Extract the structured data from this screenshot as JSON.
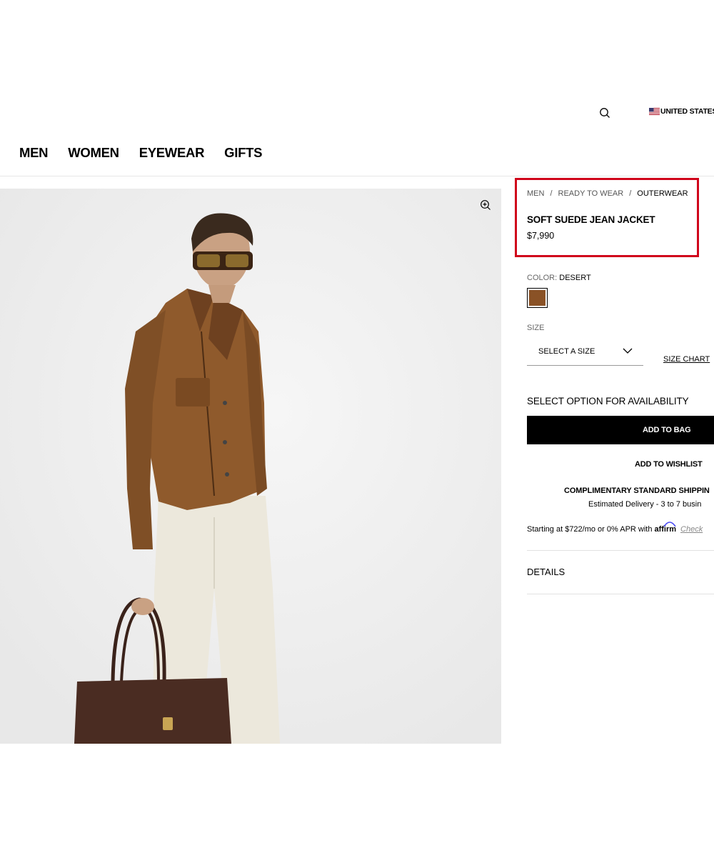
{
  "header": {
    "search_icon": "search-icon",
    "country": "UNITED STATES",
    "flag_icon": "us-flag-icon"
  },
  "nav": {
    "items": [
      "MEN",
      "WOMEN",
      "EYEWEAR",
      "GIFTS"
    ]
  },
  "product": {
    "breadcrumb": [
      "MEN",
      "READY TO WEAR",
      "OUTERWEAR"
    ],
    "breadcrumb_separator": "/",
    "title": "SOFT SUEDE JEAN JACKET",
    "price": "$7,990",
    "zoom_icon": "zoom-in-icon",
    "highlight_color": "#d0021b"
  },
  "options": {
    "color_label": "COLOR:",
    "color_value": "DESERT",
    "swatch_color": "#8a5226",
    "size_label": "SIZE",
    "size_select": "SELECT A SIZE",
    "size_chart": "SIZE CHART",
    "availability": "SELECT OPTION FOR AVAILABILITY"
  },
  "actions": {
    "add_to_bag": "ADD TO BAG",
    "add_to_wishlist": "ADD TO WISHLIST"
  },
  "shipping": {
    "title": "COMPLIMENTARY STANDARD SHIPPIN",
    "delivery": "Estimated Delivery - 3 to 7 busin"
  },
  "financing": {
    "text": "Starting at $722/mo or 0% APR with",
    "brand": "affirm",
    "link": "Check"
  },
  "details": {
    "label": "DETAILS"
  }
}
